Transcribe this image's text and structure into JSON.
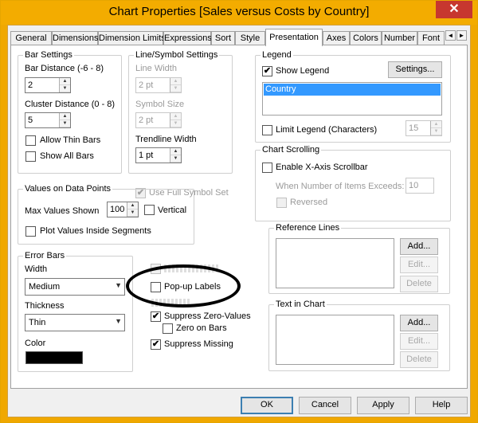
{
  "window": {
    "title": "Chart Properties [Sales versus Costs by Country]",
    "close_glyph": "✕"
  },
  "tabs": [
    "General",
    "Dimensions",
    "Dimension Limits",
    "Expressions",
    "Sort",
    "Style",
    "Presentation",
    "Axes",
    "Colors",
    "Number",
    "Font"
  ],
  "active_tab": "Presentation",
  "tab_scroll": {
    "left": "◄",
    "right": "►"
  },
  "bar_settings": {
    "title": "Bar Settings",
    "bar_distance_label": "Bar Distance (-6 - 8)",
    "bar_distance_value": "2",
    "cluster_distance_label": "Cluster Distance (0 - 8)",
    "cluster_distance_value": "5",
    "allow_thin_bars": "Allow Thin Bars",
    "show_all_bars": "Show All Bars"
  },
  "line_symbol": {
    "title": "Line/Symbol Settings",
    "line_width_label": "Line Width",
    "line_width_value": "2 pt",
    "symbol_size_label": "Symbol Size",
    "symbol_size_value": "2 pt",
    "trendline_width_label": "Trendline Width",
    "trendline_width_value": "1 pt",
    "use_full_symbol_set": "Use Full Symbol Set"
  },
  "legend": {
    "title": "Legend",
    "show_legend": "Show Legend",
    "settings_button": "Settings...",
    "list_item": "Country",
    "limit_legend": "Limit Legend (Characters)",
    "limit_value": "15"
  },
  "chart_scrolling": {
    "title": "Chart Scrolling",
    "enable_scrollbar": "Enable X-Axis Scrollbar",
    "items_exceeds_label": "When Number of Items Exceeds:",
    "items_exceeds_value": "10",
    "reversed": "Reversed"
  },
  "values_on_points": {
    "title": "Values on Data Points",
    "max_values_label": "Max Values Shown",
    "max_values_value": "100",
    "vertical": "Vertical",
    "plot_inside": "Plot Values Inside Segments"
  },
  "error_bars": {
    "title": "Error Bars",
    "width_label": "Width",
    "width_value": "Medium",
    "thickness_label": "Thickness",
    "thickness_value": "Thin",
    "color_label": "Color",
    "color_swatch": "#000000"
  },
  "misc_options": {
    "popup_labels": "Pop-up Labels",
    "suppress_zero": "Suppress Zero-Values",
    "zero_on_bars": "Zero on Bars",
    "suppress_missing": "Suppress Missing"
  },
  "reference_lines": {
    "title": "Reference Lines",
    "add": "Add...",
    "edit": "Edit...",
    "delete": "Delete"
  },
  "text_in_chart": {
    "title": "Text in Chart",
    "add": "Add...",
    "edit": "Edit...",
    "delete": "Delete"
  },
  "footer": {
    "ok": "OK",
    "cancel": "Cancel",
    "apply": "Apply",
    "help": "Help"
  },
  "colors": {
    "title_bar": "#f3ac00",
    "close_button": "#c7372f",
    "list_selection": "#3399ff"
  }
}
